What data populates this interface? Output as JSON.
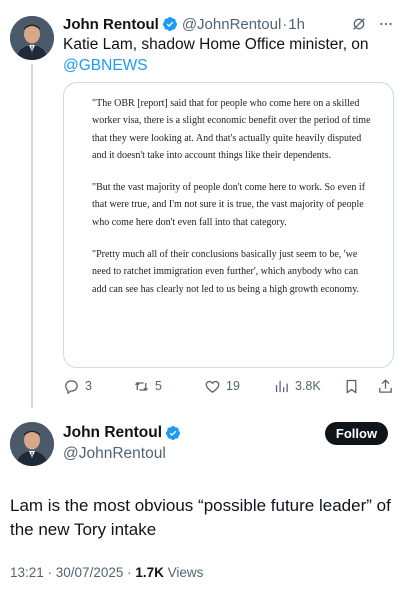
{
  "tweet1": {
    "name": "John Rentoul",
    "handle": "@JohnRentoul",
    "separator": "·",
    "time": "1h",
    "more_icon": "more-dots-icon",
    "grok_icon": "grok-icon",
    "text_main": "Katie Lam, shadow Home Office minister, on",
    "text_mention": "@GBNEWS",
    "quote": {
      "paragraph1": "\"The OBR [report] said that for people who come here on a skilled worker visa, there is a slight economic benefit over the period of time that they were looking at. And that's actually quite heavily disputed and it doesn't take into account things like their dependents.",
      "paragraph2": "\"But the vast majority of people don't come here to work. So even if that were true, and I'm not sure it is true, the vast majority of people who come here don't even fall into that category.",
      "paragraph3": "\"Pretty much all of their conclusions basically just seem to be, 'we need to ratchet immigration even further', which anybody who can add can see has clearly not led to us being a high growth economy."
    },
    "actions": {
      "replies": "3",
      "retweets": "5",
      "likes": "19",
      "views": "3.8K"
    }
  },
  "tweet2": {
    "name": "John Rentoul",
    "handle": "@JohnRentoul",
    "follow_label": "Follow",
    "text": "Lam is the most obvious “possible future leader” of the new Tory intake",
    "timestamp": "13:21 · 30/07/2025 · ",
    "views_count": "1.7K",
    "views_label": " Views"
  },
  "colors": {
    "verified": "#1d9bf0",
    "link": "#1d9bf0",
    "secondary_text": "#536471",
    "border": "#cfd9de"
  }
}
